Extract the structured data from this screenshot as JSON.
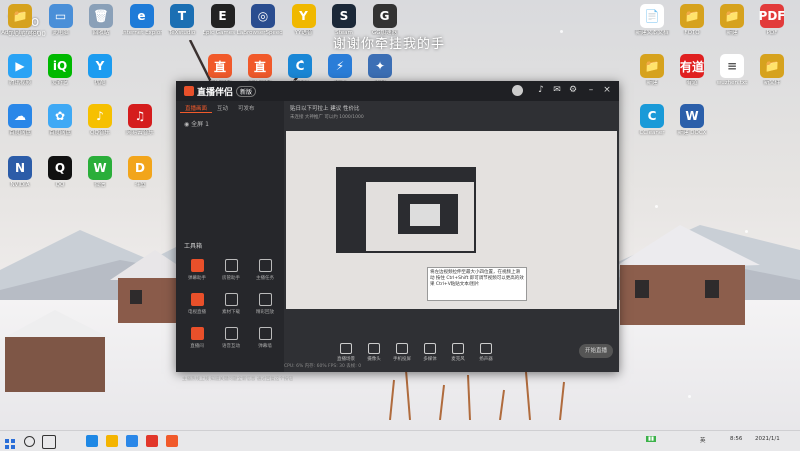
{
  "overlay_text": "谢谢你牵挂我的手",
  "watermark": {
    "line1": "YoLo",
    "line2": "0.0.0 0000"
  },
  "desktop_icons_left": [
    {
      "label": "Administrator",
      "color": "#d6a21e",
      "glyph": "📁"
    },
    {
      "label": "此电脑",
      "color": "#4a8fd8",
      "glyph": "▭"
    },
    {
      "label": "回收站",
      "color": "#8aa0b8",
      "glyph": "🗑"
    },
    {
      "label": "Internet Explorer",
      "color": "#1e7bd8",
      "glyph": "e"
    },
    {
      "label": "TeXstudio",
      "color": "#1b6fb3",
      "glyph": "T"
    },
    {
      "label": "Epic Games Launcher",
      "color": "#222222",
      "glyph": "E"
    },
    {
      "label": "BrowserSpeed",
      "color": "#2a4d8f",
      "glyph": "◎"
    },
    {
      "label": "YY语音",
      "color": "#f0b800",
      "glyph": "Y"
    },
    {
      "label": "Steam",
      "color": "#1b2838",
      "glyph": "S"
    },
    {
      "label": "GG加速器",
      "color": "#333333",
      "glyph": "G"
    }
  ],
  "desktop_icons_row2": [
    {
      "label": "腾讯视频",
      "color": "#2aa3f5",
      "glyph": "▶"
    },
    {
      "label": "爱奇艺",
      "color": "#00b900",
      "glyph": "iQ"
    },
    {
      "label": "优酷",
      "color": "#1c9cf0",
      "glyph": "Y"
    },
    {
      "label": "直播伴侣",
      "color": "#f15a2b",
      "glyph": "直"
    },
    {
      "label": "直播伴侣",
      "color": "#f15a2b",
      "glyph": "直"
    },
    {
      "label": "加速器",
      "color": "#1a87d6",
      "glyph": "C"
    },
    {
      "label": "迅游",
      "color": "#2a7dd8",
      "glyph": "⚡"
    },
    {
      "label": "工具",
      "color": "#3c6fb5",
      "glyph": "✦"
    }
  ],
  "desktop_icons_col1": [
    {
      "label": "百度网盘",
      "color": "#2a87e8",
      "glyph": "☁"
    },
    {
      "label": "百度网盘",
      "color": "#3fa9f5",
      "glyph": "✿"
    },
    {
      "label": "QQ音乐",
      "color": "#f6c000",
      "glyph": "♪"
    },
    {
      "label": "网易云音乐",
      "color": "#d51d1d",
      "glyph": "♫"
    },
    {
      "label": "NVIDIA",
      "color": "#2c5ca8",
      "glyph": "N"
    },
    {
      "label": "QQ",
      "color": "#111111",
      "glyph": "Q"
    },
    {
      "label": "微信",
      "color": "#2aae3a",
      "glyph": "W"
    },
    {
      "label": "斗鱼",
      "color": "#f2a51b",
      "glyph": "D"
    }
  ],
  "desktop_icons_right": [
    {
      "label": "新建文本文档",
      "color": "#ffffff",
      "glyph": "📄"
    },
    {
      "label": "FOTO",
      "color": "#d6a21e",
      "glyph": "📁"
    },
    {
      "label": "新建",
      "color": "#d6a21e",
      "glyph": "📁"
    },
    {
      "label": "PDF",
      "color": "#e23b3b",
      "glyph": "PDF"
    },
    {
      "label": "新建",
      "color": "#d6a21e",
      "glyph": "📁"
    },
    {
      "label": "有道",
      "color": "#e02020",
      "glyph": "有道"
    },
    {
      "label": "wuzhen.txt",
      "color": "#ffffff",
      "glyph": "≡"
    },
    {
      "label": "新文件",
      "color": "#d6a21e",
      "glyph": "📁"
    },
    {
      "label": "CCleaner",
      "color": "#1a9ad8",
      "glyph": "C"
    },
    {
      "label": "新建 DOCX",
      "color": "#2b5faa",
      "glyph": "W"
    }
  ],
  "app": {
    "name": "直播伴侣",
    "version": "新版",
    "tabs": [
      "直播画面",
      "互动",
      "可发布"
    ],
    "scene_label": "全屏 1",
    "status_line": "贴日以下可拉上 建议 性价比",
    "status_line2": "未连接 大神推广 可以约 1000/1000",
    "tools_title": "工具箱",
    "tools": [
      {
        "label": "弹幕助手",
        "hot": true
      },
      {
        "label": "房管助手",
        "hot": false
      },
      {
        "label": "主播任务",
        "hot": false
      },
      {
        "label": "电视直播",
        "hot": true
      },
      {
        "label": "素材下载",
        "hot": false
      },
      {
        "label": "精彩回放",
        "hot": false
      },
      {
        "label": "直播间",
        "hot": true
      },
      {
        "label": "语音互动",
        "hot": false
      },
      {
        "label": "弹幕墙",
        "hot": false
      }
    ],
    "left_note": "主播热线上线 知道关键问题全新信息 通过回复这个按钮",
    "bottom_buttons": [
      "直播场景",
      "摄像头",
      "手机投屏",
      "多媒体",
      "麦克风",
      "扬声器"
    ],
    "go_live": "开始直播",
    "tooltip": "将左边视频拉伸至最大小四位置，在视频上滑动 按住 Ctrl+Shift 即可调节视频可以更高的效果 Ctrl+V粘贴文本/图片",
    "status_bar": "CPU: 6%   内存: 60%   FPS: 30  丢帧: 0"
  },
  "taskbar": {
    "tray": [
      "英",
      "8:56",
      "2021/1/1"
    ]
  }
}
